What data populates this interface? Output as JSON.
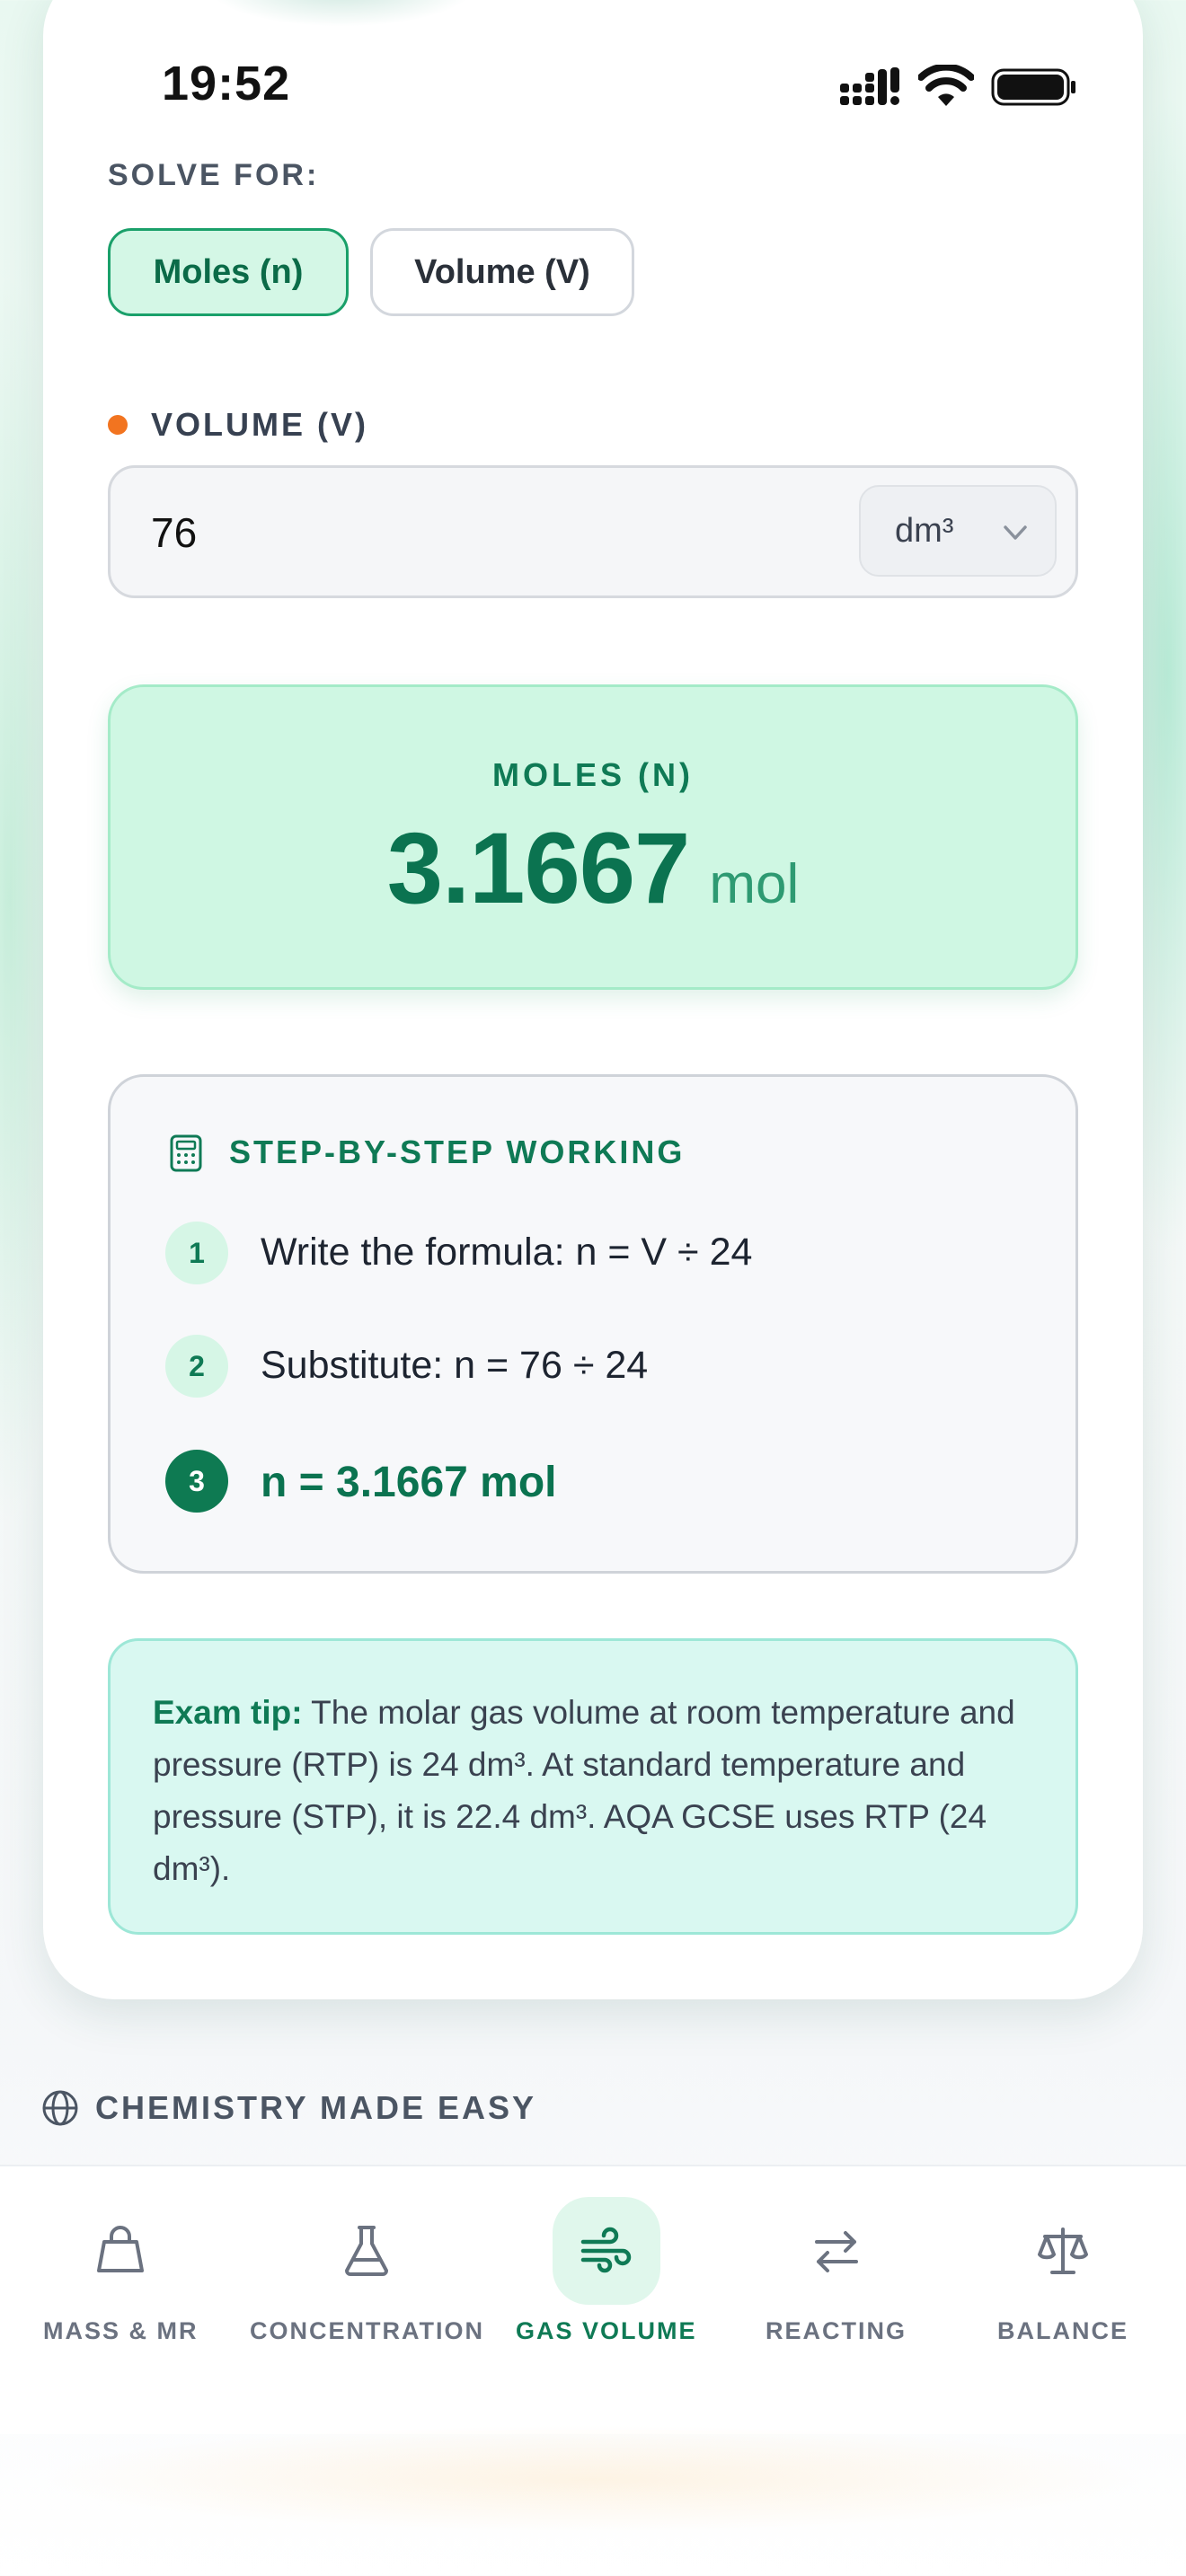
{
  "status_bar": {
    "time": "19:52"
  },
  "solve_for": {
    "label": "SOLVE FOR:",
    "options": [
      {
        "label": "Moles (n)",
        "active": true
      },
      {
        "label": "Volume (V)",
        "active": false
      }
    ]
  },
  "volume_input": {
    "label": "VOLUME (V)",
    "value": "76",
    "unit": "dm³"
  },
  "result": {
    "label": "MOLES (N)",
    "value": "3.1667",
    "unit": "mol"
  },
  "steps": {
    "title": "STEP-BY-STEP WORKING",
    "items": [
      {
        "num": "1",
        "text": "Write the formula: n = V ÷ 24"
      },
      {
        "num": "2",
        "text": "Substitute: n = 76 ÷ 24"
      },
      {
        "num": "3",
        "text": "n = 3.1667 mol"
      }
    ]
  },
  "tip": {
    "label": "Exam tip:",
    "text": "The molar gas volume at room temperature and pressure (RTP) is 24 dm³. At standard temperature and pressure (STP), it is 22.4 dm³. AQA GCSE uses RTP (24 dm³)."
  },
  "footer": {
    "brand": "CHEMISTRY MADE EASY",
    "icon": "globe-icon"
  },
  "tabs": [
    {
      "label": "MASS & MR",
      "icon": "bag-icon",
      "active": false
    },
    {
      "label": "CONCENTRATION",
      "icon": "flask-icon",
      "active": false
    },
    {
      "label": "GAS VOLUME",
      "icon": "wind-icon",
      "active": true
    },
    {
      "label": "REACTING",
      "icon": "arrows-swap-icon",
      "active": false
    },
    {
      "label": "BALANCE",
      "icon": "scale-icon",
      "active": false
    }
  ],
  "colors": {
    "accent": "#0f7a55",
    "result_bg": "#cff7e3",
    "tip_bg": "#d9f8f1",
    "dot": "#f27420"
  }
}
